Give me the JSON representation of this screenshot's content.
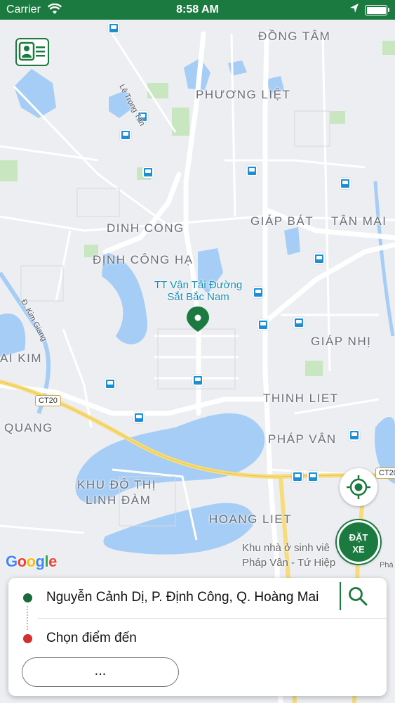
{
  "status_bar": {
    "carrier": "Carrier",
    "time": "8:58 AM",
    "battery_level": 1.0
  },
  "map": {
    "districts": [
      "ĐỒNG TÂM",
      "PHƯƠNG LIỆT",
      "GIÁP BÁT",
      "TÂN MAI",
      "DINH CONG",
      "ĐỊNH CÔNG HẠ",
      "GIÁP NHỊ",
      "AI KIM",
      "THINH LIET",
      "QUANG",
      "PHÁP VÂN",
      "HOANG LIET"
    ],
    "area_label_line1": "KHU ĐÔ THỊ",
    "area_label_line2": "LINH ĐÀM",
    "street_le_trong_tan": "Lê Trọng Tấn",
    "street_kim_giang": "Đ. Kim Giang",
    "transit_line1": "TT Vận Tải Đường",
    "transit_line2": "Sắt Bắc Nam",
    "poi_line1": "Khu nhà ở sinh viê",
    "poi_line2": "Pháp Vân - Tứ Hiệp",
    "poi_edge": "Phá",
    "road_ct20_left": "CT20",
    "road_ct20_right": "CT20",
    "google_logo": [
      "G",
      "o",
      "o",
      "g",
      "l",
      "e"
    ],
    "colors": {
      "water": "#a6cdf5",
      "park": "#c8e6c0",
      "road_major": "#ffffff",
      "highway": "#f7dc7a",
      "brand_green": "#1b7a3f"
    }
  },
  "book_button": {
    "line1": "ĐẶT",
    "line2": "XE"
  },
  "panel": {
    "origin": "Nguyễn Cảnh Dị, P. Định Công, Q. Hoàng Mai",
    "destination_placeholder": "Chọn điểm đến",
    "more_label": "..."
  }
}
